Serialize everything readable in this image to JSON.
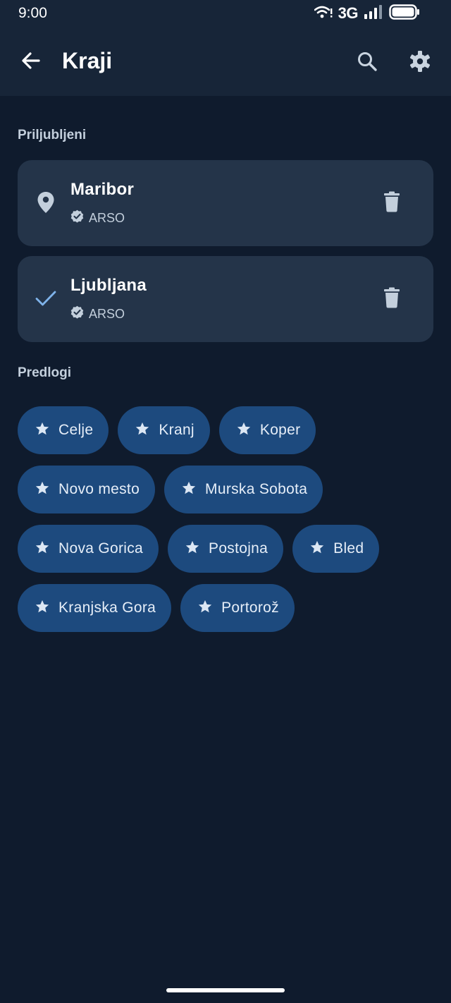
{
  "status_bar": {
    "time": "9:00",
    "network": "3G",
    "icons": [
      "wifi-icon",
      "signal-icon",
      "battery-icon"
    ]
  },
  "app_bar": {
    "title": "Kraji",
    "icons": [
      "back-arrow-icon",
      "search-icon",
      "gear-icon"
    ]
  },
  "favorites": {
    "header": "Priljubljeni",
    "items": [
      {
        "name": "Maribor",
        "source": "ARSO",
        "lead_icon": "location-pin-icon"
      },
      {
        "name": "Ljubljana",
        "source": "ARSO",
        "lead_icon": "check-icon"
      }
    ]
  },
  "suggestions": {
    "header": "Predlogi",
    "items": [
      {
        "label": "Celje"
      },
      {
        "label": "Kranj"
      },
      {
        "label": "Koper"
      },
      {
        "label": "Novo mesto"
      },
      {
        "label": "Murska Sobota"
      },
      {
        "label": "Nova Gorica"
      },
      {
        "label": "Postojna"
      },
      {
        "label": "Bled"
      },
      {
        "label": "Kranjska Gora"
      },
      {
        "label": "Portorož"
      }
    ]
  },
  "colors": {
    "background": "#0f1b2d",
    "top_bar": "#172538",
    "card": "#243449",
    "chip": "#1d4a7e",
    "accent_check": "#7fb3ea"
  }
}
